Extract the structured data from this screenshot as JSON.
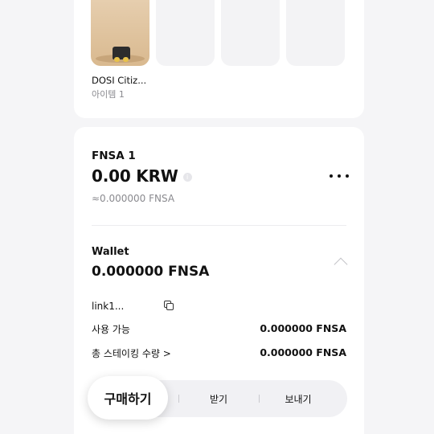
{
  "items": {
    "first": {
      "name": "DOSI Citiz...",
      "count": "아이템 1"
    }
  },
  "token": {
    "name": "FNSA 1",
    "fiat_value": "0.00 KRW",
    "approx": "≈0.000000 FNSA"
  },
  "wallet": {
    "label": "Wallet",
    "balance": "0.000000 FNSA",
    "address": "link1...",
    "rows": [
      {
        "label": "사용 가능",
        "value": "0.000000 FNSA"
      },
      {
        "label": "총 스테이킹 수량 >",
        "value": "0.000000 FNSA"
      }
    ]
  },
  "actions": {
    "buy": "구매하기",
    "receive": "받기",
    "send": "보내기"
  },
  "icons": {
    "info": "info-icon",
    "more": "more-icon",
    "chevron": "chevron-up-icon",
    "copy": "copy-icon"
  }
}
